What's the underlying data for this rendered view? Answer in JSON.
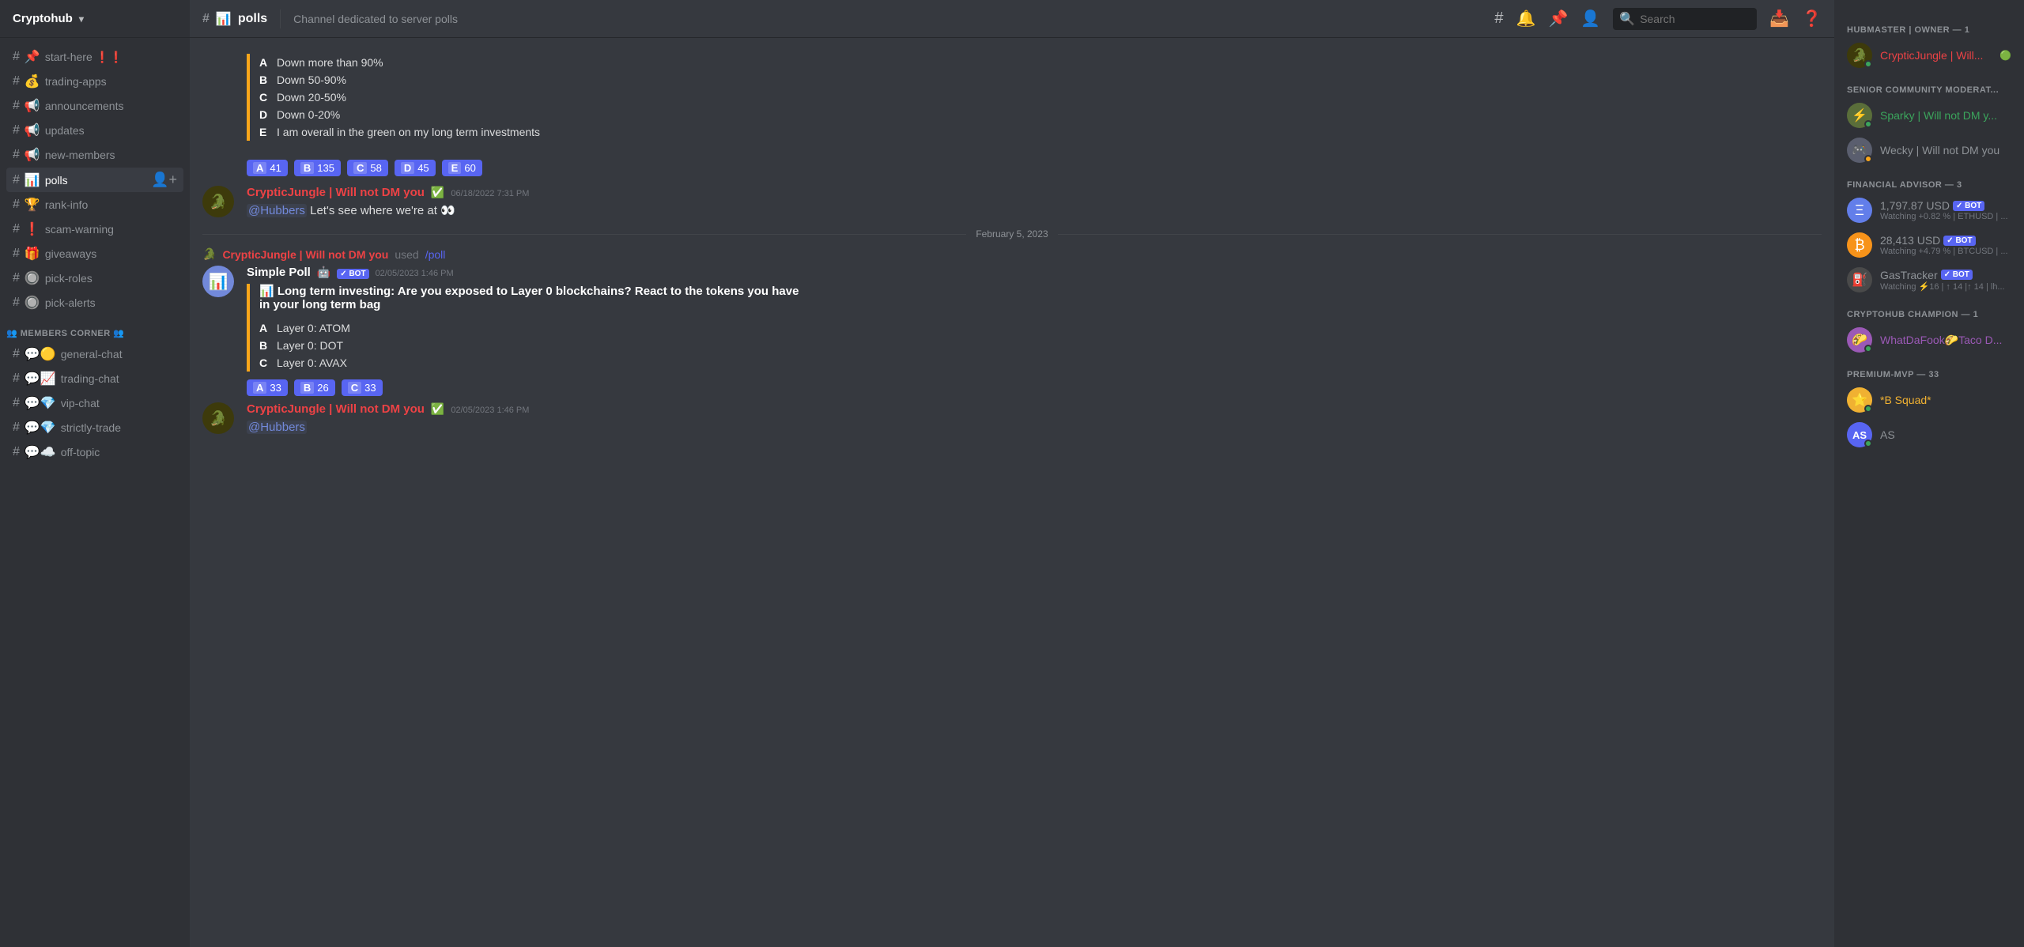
{
  "server": {
    "name": "Cryptohub",
    "icon": "🔐"
  },
  "topbar": {
    "channel_icon": "📊",
    "channel_name": "polls",
    "description": "Channel dedicated to server polls",
    "search_placeholder": "Search"
  },
  "channels": [
    {
      "id": "start-here",
      "name": "start-here ❗❗",
      "icon": "📌",
      "category": null
    },
    {
      "id": "trading-apps",
      "name": "trading-apps",
      "icon": "💰",
      "category": null
    },
    {
      "id": "announcements",
      "name": "announcements",
      "icon": "📢",
      "category": null
    },
    {
      "id": "updates",
      "name": "updates",
      "icon": "📢",
      "category": null
    },
    {
      "id": "new-members",
      "name": "new-members",
      "icon": "📢",
      "category": null
    },
    {
      "id": "polls",
      "name": "polls",
      "icon": "📊",
      "active": true,
      "category": null
    },
    {
      "id": "rank-info",
      "name": "rank-info",
      "icon": "🏆",
      "category": null
    },
    {
      "id": "scam-warning",
      "name": "scam-warning",
      "icon": "❗",
      "category": null
    },
    {
      "id": "giveaways",
      "name": "giveaways",
      "icon": "🎁",
      "category": null
    },
    {
      "id": "pick-roles",
      "name": "pick-roles",
      "icon": "🔘",
      "category": null
    },
    {
      "id": "pick-alerts",
      "name": "pick-alerts",
      "icon": "🔘",
      "category": null
    }
  ],
  "members_corner": {
    "label": "👥 MEMBERS CORNER 👥",
    "channels": [
      {
        "id": "general-chat",
        "name": "general-chat",
        "icon": "💬🟡"
      },
      {
        "id": "trading-chat",
        "name": "trading-chat",
        "icon": "💬📈"
      },
      {
        "id": "vip-chat",
        "name": "vip-chat",
        "icon": "💬💎"
      },
      {
        "id": "strictly-trade",
        "name": "strictly-trade",
        "icon": "💬💎"
      },
      {
        "id": "off-topic",
        "name": "off-topic",
        "icon": "💬☁️"
      }
    ]
  },
  "messages": [
    {
      "id": "poll1",
      "type": "poll_votes",
      "options_label": "A  Down more than 90%\nB  Down 50-90%\nC  Down 20-50%\nD  Down 0-20%\nE  I am overall in the green on my long term investments",
      "votes": [
        {
          "letter": "A",
          "count": "41"
        },
        {
          "letter": "B",
          "count": "135"
        },
        {
          "letter": "C",
          "count": "58"
        },
        {
          "letter": "D",
          "count": "45"
        },
        {
          "letter": "E",
          "count": "60"
        }
      ]
    },
    {
      "id": "msg1",
      "type": "chat",
      "author": "CrypticJungle | Will not DM you",
      "author_color": "red",
      "verified": true,
      "timestamp": "06/18/2022 7:31 PM",
      "content": "@Hubbers Let's see where we're at 👀"
    },
    {
      "id": "date1",
      "type": "date_separator",
      "label": "February 5, 2023"
    },
    {
      "id": "sys1",
      "type": "system",
      "author": "CrypticJungle | Will not DM you",
      "author_color": "red",
      "action": "used",
      "command": "/poll"
    },
    {
      "id": "poll2",
      "type": "poll_full",
      "bot_name": "Simple Poll",
      "timestamp": "02/05/2023 1:46 PM",
      "title": "📊 Long term investing: Are you exposed to Layer 0 blockchains? React to the tokens you have in your long term bag",
      "options": [
        {
          "letter": "A",
          "text": "Layer 0: ATOM"
        },
        {
          "letter": "B",
          "text": "Layer 0: DOT"
        },
        {
          "letter": "C",
          "text": "Layer 0: AVAX"
        }
      ],
      "votes": [
        {
          "letter": "A",
          "count": "33"
        },
        {
          "letter": "B",
          "count": "26"
        },
        {
          "letter": "C",
          "count": "33"
        }
      ]
    },
    {
      "id": "msg2",
      "type": "chat",
      "author": "CrypticJungle | Will not DM you",
      "author_color": "red",
      "verified": true,
      "timestamp": "02/05/2023 1:46 PM",
      "content": "@Hubbers"
    }
  ],
  "members": {
    "hubmaster": {
      "label": "HUBMASTER | OWNER — 1",
      "members": [
        {
          "name": "CrypticJungle | Will...",
          "color": "red",
          "status": "online",
          "has_dot": true,
          "avatar_bg": "#ed4245",
          "avatar_emoji": "🐊"
        }
      ]
    },
    "senior_mod": {
      "label": "SENIOR COMMUNITY MODERAT...",
      "members": [
        {
          "name": "Sparky | Will not DM y...",
          "color": "green-text",
          "status": "online",
          "avatar_bg": "#43b581",
          "avatar_emoji": "⚡"
        },
        {
          "name": "Wecky | Will not DM you",
          "color": "gray",
          "status": "idle",
          "avatar_bg": "#7289da",
          "avatar_emoji": "🎮"
        }
      ]
    },
    "financial_advisor": {
      "label": "FINANCIAL ADVISOR — 3",
      "members": [
        {
          "name": "1,797.87 USD",
          "sub": "Watching +0.82 % | ETHUSD | ...",
          "color": "gray",
          "is_bot": true,
          "avatar_bg": "#627eea",
          "avatar_emoji": "Ξ"
        },
        {
          "name": "28,413 USD",
          "sub": "Watching +4.79 % | BTCUSD | ...",
          "color": "gray",
          "is_bot": true,
          "avatar_bg": "#f7931a",
          "avatar_emoji": "₿"
        },
        {
          "name": "GasTracker",
          "sub": "Watching ⚡16 | ↑ 14 |↑ 14 | lh...",
          "color": "gray",
          "is_bot": true,
          "avatar_bg": "#4a4a4a",
          "avatar_emoji": "⛽"
        }
      ]
    },
    "champion": {
      "label": "CRYPTOHUB CHAMPION — 1",
      "members": [
        {
          "name": "WhatDaFook🌮Taco D...",
          "color": "purple-text",
          "status": "online",
          "avatar_bg": "#9b59b6",
          "avatar_emoji": "🌮"
        }
      ]
    },
    "premium_mvp": {
      "label": "PREMIUM-MVP — 33",
      "members": [
        {
          "name": "*B Squad*",
          "color": "gold",
          "status": "online",
          "avatar_bg": "#f0b132",
          "avatar_emoji": "⭐"
        },
        {
          "name": "AS",
          "color": "gray",
          "status": "online",
          "avatar_bg": "#5865f2",
          "avatar_emoji": "AS"
        }
      ]
    }
  }
}
